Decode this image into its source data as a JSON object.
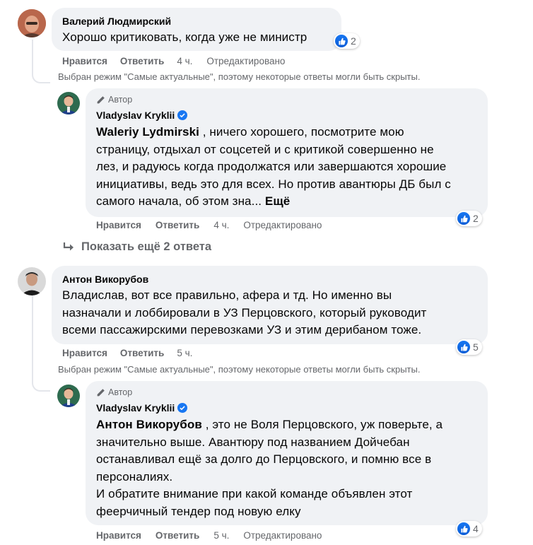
{
  "comments": [
    {
      "author": "Валерий Людмирский",
      "text": "Хорошо критиковать, когда уже не министр",
      "like_label": "Нравится",
      "reply_label": "Ответить",
      "time": "4 ч.",
      "edited": "Отредактировано",
      "reactions": "2",
      "sort_notice": "Выбран режим \"Самые актуальные\", поэтому некоторые ответы могли быть скрыты."
    },
    {
      "author_badge": "Автор",
      "author": "Vladyslav Kryklii",
      "mention": "Waleriy Lydmirski",
      "text_lines": [
        ", ничего хорошего, посмотрите мою",
        "страницу, отдыхал от соцсетей и с критикой совершенно не",
        "лез, и радуюсь когда продолжатся или завершаются хорошие",
        "инициативы, ведь это для всех. Но против авантюры ДБ был с",
        "самого начала, об этом зна..."
      ],
      "see_more": "Ещё",
      "like_label": "Нравится",
      "reply_label": "Ответить",
      "time": "4 ч.",
      "edited": "Отредактировано",
      "reactions": "2"
    },
    {
      "show_more_replies": "Показать ещё 2 ответа"
    },
    {
      "author": "Антон Викорубов",
      "text_lines": [
        "Владислав, вот все правильно, афера и тд. Но именно вы",
        "назначали и лоббировали в УЗ Перцовского, который руководит",
        "всеми пассажирскими перевозками УЗ и этим дерибаном тоже."
      ],
      "like_label": "Нравится",
      "reply_label": "Ответить",
      "time": "5 ч.",
      "reactions": "5",
      "sort_notice": "Выбран режим \"Самые актуальные\", поэтому некоторые ответы могли быть скрыты."
    },
    {
      "author_badge": "Автор",
      "author": "Vladyslav Kryklii",
      "mention": "Антон Викорубов",
      "text_lines": [
        ", это не Воля Перцовского, уж поверьте, а",
        "значительно выше. Авантюру под названием Дойчебан",
        "останавливал ещё за долго до Перцовского, и помню все в",
        "персоналиях.",
        "И обратите внимание при какой команде объявлен этот",
        "феерчичный тендер под новую елку"
      ],
      "like_label": "Нравится",
      "reply_label": "Ответить",
      "time": "5 ч.",
      "edited": "Отредактировано",
      "reactions": "4"
    }
  ]
}
